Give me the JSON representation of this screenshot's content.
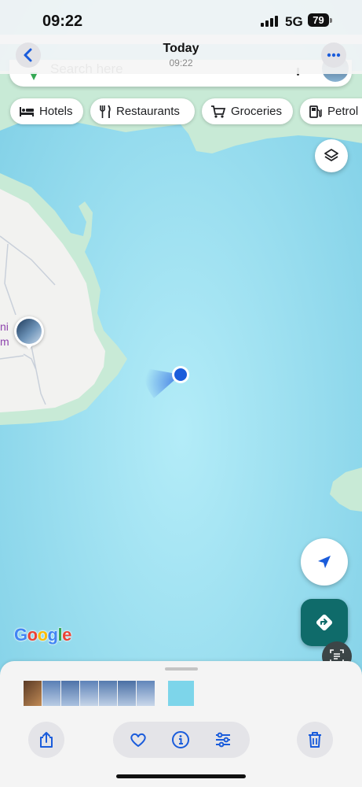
{
  "status_bar": {
    "time": "09:22",
    "network": "5G",
    "battery": "79"
  },
  "header": {
    "title": "Today",
    "subtitle": "09:22"
  },
  "search": {
    "text": "Search here"
  },
  "chips": [
    {
      "label": "Hotels",
      "icon": "bed-icon"
    },
    {
      "label": "Restaurants",
      "icon": "fork-knife-icon"
    },
    {
      "label": "Groceries",
      "icon": "cart-icon"
    },
    {
      "label": "Petrol",
      "icon": "fuel-icon"
    }
  ],
  "map": {
    "place_label_line1": "ni",
    "place_label_line2": "m",
    "attribution": "Google",
    "colors": {
      "water": "#8fd9ee",
      "land": "#c7e9d4",
      "urban": "#f1f1ef",
      "location": "#1a5cdb"
    }
  },
  "bottom_sheet": {
    "photo_count": 8
  },
  "toolbar": {
    "share": "share-icon",
    "favorite": "heart-icon",
    "info": "info-icon",
    "adjust": "sliders-icon",
    "delete": "trash-icon"
  }
}
